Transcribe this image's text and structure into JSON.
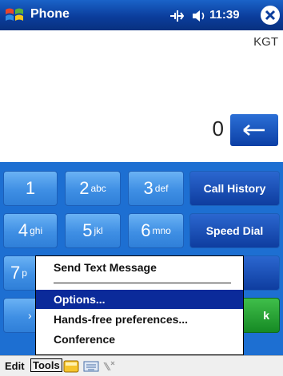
{
  "titlebar": {
    "title": "Phone",
    "time": "11:39"
  },
  "operator": "KGT",
  "display_number": "0",
  "keypad": {
    "keys": [
      {
        "digit": "1",
        "letters": ""
      },
      {
        "digit": "2",
        "letters": "abc"
      },
      {
        "digit": "3",
        "letters": "def"
      },
      {
        "digit": "4",
        "letters": "ghi"
      },
      {
        "digit": "5",
        "letters": "jkl"
      },
      {
        "digit": "6",
        "letters": "mno"
      },
      {
        "digit": "7",
        "letters": "p"
      },
      {
        "digit": "*",
        "letters": ""
      }
    ],
    "call_history": "Call History",
    "speed_dial": "Speed Dial",
    "talk_partial": "k"
  },
  "menu": {
    "items": [
      "Send Text Message",
      "Options...",
      "Hands-free preferences...",
      "Conference"
    ],
    "selected_index": 1
  },
  "menubar": {
    "edit": "Edit",
    "tools": "Tools"
  },
  "colors": {
    "titlebar": "#0b3d9c",
    "keypad_bg": "#1d6fd2",
    "key_light": "#4f9ce9",
    "key_dark": "#0e3d9f",
    "selection": "#0b2a9a"
  }
}
